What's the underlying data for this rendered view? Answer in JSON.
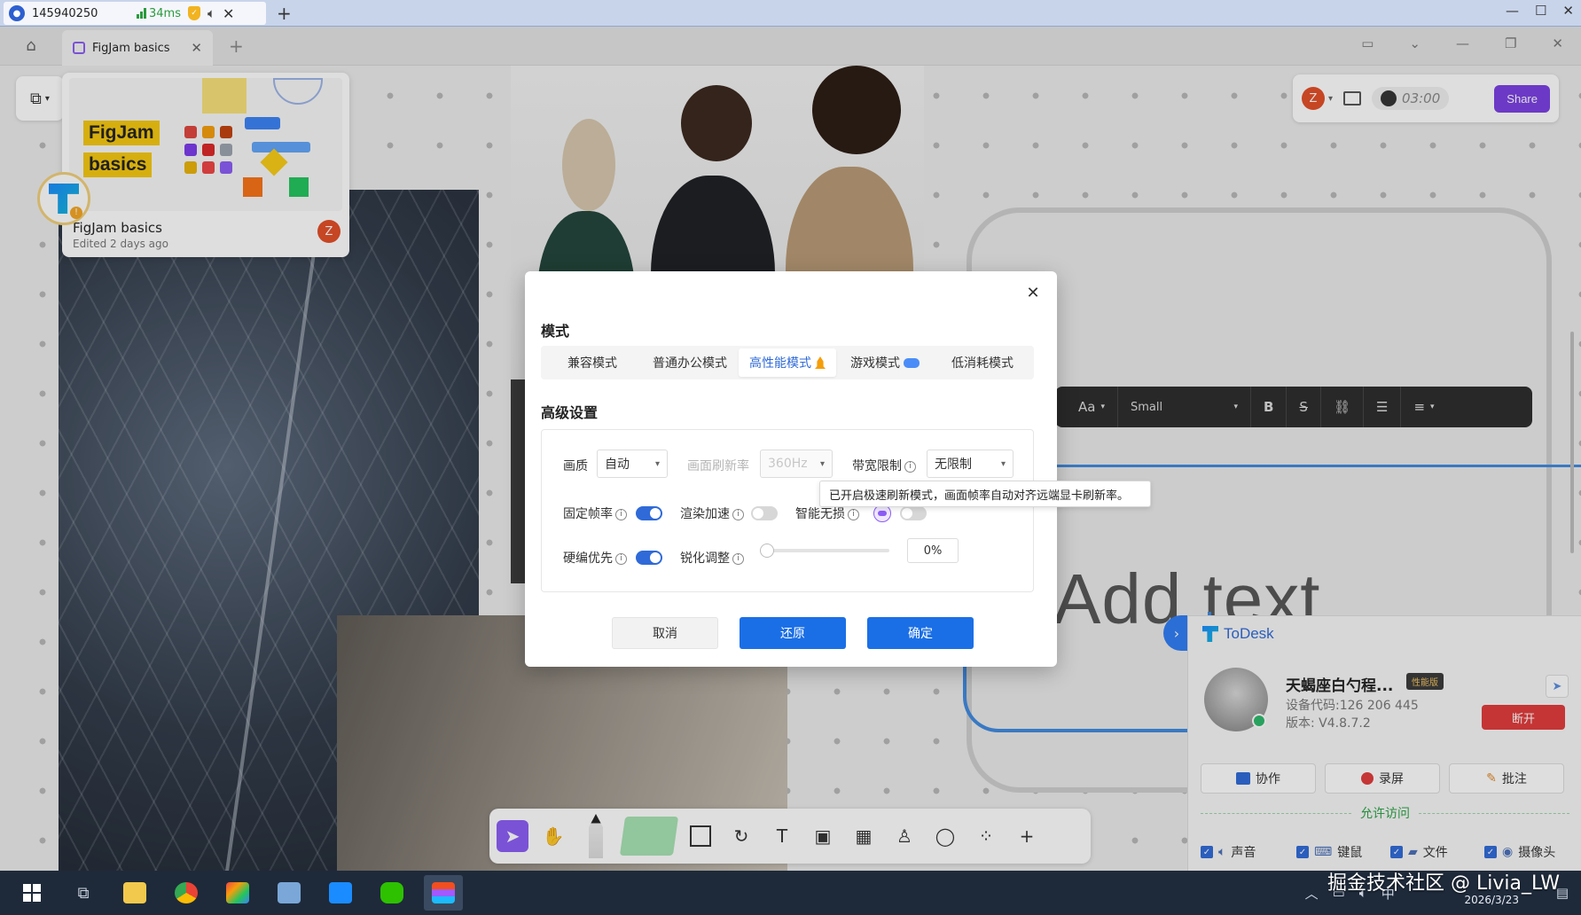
{
  "session": {
    "id": "145940250",
    "latency": "34ms"
  },
  "app": {
    "tab_title": "FigJam basics"
  },
  "file_card": {
    "title": "FigJam basics",
    "edited": "Edited 2 days ago",
    "owner_initial": "Z",
    "thumb_tag_1": "FigJam",
    "thumb_tag_2": "basics"
  },
  "top_bar": {
    "user_initial": "Z",
    "timer": "03:00",
    "share_label": "Share"
  },
  "text_toolbar": {
    "font_icon": "Aa",
    "size_value": "Small",
    "bold": "B",
    "strike": "S"
  },
  "board": {
    "placeholder": "Add text"
  },
  "dialog": {
    "mode_heading": "模式",
    "modes": [
      "兼容模式",
      "普通办公模式",
      "高性能模式",
      "游戏模式",
      "低消耗模式"
    ],
    "active_mode_index": 2,
    "advanced_heading": "高级设置",
    "quality_label": "画质",
    "quality_value": "自动",
    "refresh_label": "画面刷新率",
    "refresh_value": "360Hz",
    "bandwidth_label": "带宽限制",
    "bandwidth_value": "无限制",
    "fixed_fps_label": "固定帧率",
    "fixed_fps_on": true,
    "render_accel_label": "渲染加速",
    "render_accel_on": false,
    "smart_lossless_label": "智能无损",
    "smart_lossless_on": false,
    "hw_encode_label": "硬编优先",
    "hw_encode_on": true,
    "sharpen_label": "锐化调整",
    "sharpen_value": "0%",
    "sharpen_level": 0,
    "tooltip": "已开启极速刷新模式，画面帧率自动对齐远端显卡刷新率。",
    "cancel": "取消",
    "restore": "还原",
    "confirm": "确定"
  },
  "todesk": {
    "brand": "ToDesk",
    "device_name": "天蝎座白勺程...",
    "badge": "性能版",
    "device_code": "设备代码:126 206 445",
    "version": "版本: V4.8.7.2",
    "disconnect": "断开",
    "actions": [
      "协作",
      "录屏",
      "批注"
    ],
    "allow_heading": "允许访问",
    "permissions": [
      "声音",
      "键鼠",
      "文件",
      "摄像头"
    ]
  },
  "taskbar": {
    "ime": "中",
    "date": "2026/3/23"
  },
  "watermark": "掘金技术社区 @ Livia_LW",
  "colors": {
    "accent": "#1b6fe6",
    "figjam_purple": "#7b3fe4",
    "danger": "#e23b3b",
    "allow_green": "#2aa345"
  }
}
